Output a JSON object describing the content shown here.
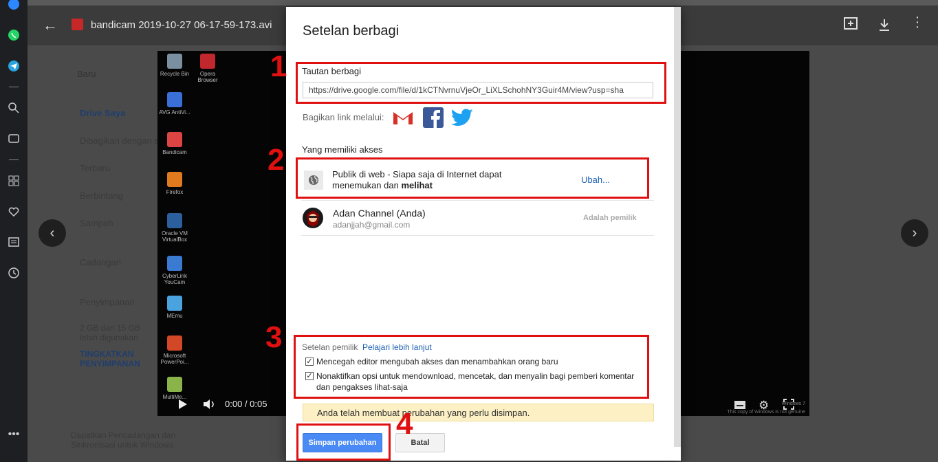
{
  "viewer": {
    "file_name": "bandicam 2019-10-27 06-17-59-173.avi",
    "time": "0:00 / 0:05",
    "windows_note_1": "Windows 7",
    "windows_note_2": "This copy of Windows is not genuine"
  },
  "desktop_icons": [
    {
      "label": "Recycle Bin",
      "color": "#7a8fa0"
    },
    {
      "label": "Opera Browser",
      "color": "#c0282d"
    },
    {
      "label": "AVG AntiVi...",
      "color": "#3a6fd8"
    },
    {
      "label": "Bandicam",
      "color": "#d44"
    },
    {
      "label": "Firefox",
      "color": "#e07a1f"
    },
    {
      "label": "Oracle VM VirtualBox",
      "color": "#2b5f9e"
    },
    {
      "label": "CyberLink YouCam",
      "color": "#3a7ad0"
    },
    {
      "label": "MEmu",
      "color": "#4aa3df"
    },
    {
      "label": "Microsoft PowerPoi...",
      "color": "#d24726"
    },
    {
      "label": "MultiMe...",
      "color": "#8ab34a"
    }
  ],
  "drive_bg": {
    "new_button": "Baru",
    "items": [
      "Drive Saya",
      "Dibagikan dengan saya",
      "Terbaru",
      "Berbintang",
      "Sampah",
      "Cadangan",
      "Penyimpanan"
    ],
    "storage": "2 GB dari 15 GB telah digunakan",
    "upgrade": "TINGKATKAN PENYIMPANAN",
    "backup_promo": "Dapatkan Pencadangan dan Sinkronisasi untuk Windows"
  },
  "dialog": {
    "title": "Setelan berbagi",
    "link_label": "Tautan berbagi",
    "link_value": "https://drive.google.com/file/d/1kCTNvrnuVjeOr_LiXLSchohNY3Guir4M/view?usp=sha",
    "share_via_label": "Bagikan link melalui:",
    "access_heading": "Yang memiliki akses",
    "public_line1": "Publik di web - Siapa saja di Internet dapat",
    "public_line2_prefix": "menemukan dan ",
    "public_line2_bold": "melihat",
    "change_link": "Ubah...",
    "owner_name": "Adan Channel (Anda)",
    "owner_email": "adanjjah@gmail.com",
    "owner_role": "Adalah pemilik",
    "owner_settings_label": "Setelan pemilik",
    "learn_more": "Pelajari lebih lanjut",
    "option1": "Mencegah editor mengubah akses dan menambahkan orang baru",
    "option2_line1": "Nonaktifkan opsi untuk mendownload, mencetak, dan menyalin bagi pemberi komentar",
    "option2_line2": "dan pengakses lihat-saja",
    "notice": "Anda telah membuat perubahan yang perlu disimpan.",
    "save_button": "Simpan perubahan",
    "cancel_button": "Batal"
  },
  "annotations": [
    "1",
    "2",
    "3",
    "4"
  ],
  "colors": {
    "annotation": "#e01010",
    "primary": "#4a8af4",
    "link": "#1a5fb4",
    "notice_bg": "#fcf0c4"
  }
}
